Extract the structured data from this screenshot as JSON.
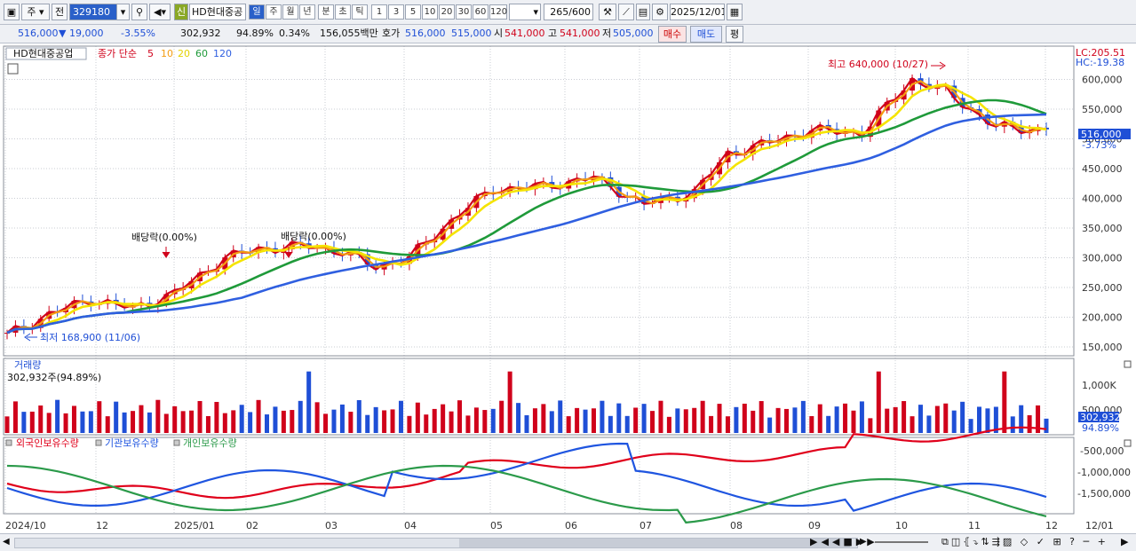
{
  "toolbar": {
    "mode_select": "주",
    "prev_label": "전",
    "code": "329180",
    "new_badge": "신",
    "stock_name": "HD현대중공",
    "periods": [
      "일",
      "주",
      "월",
      "년",
      "분",
      "초",
      "틱"
    ],
    "active_period": "일",
    "tick_units": [
      "1",
      "3",
      "5",
      "10",
      "20",
      "30",
      "60",
      "120"
    ],
    "count": "265",
    "count_max": "/600",
    "date": "2025/12/01"
  },
  "quote": {
    "price": "516,000",
    "change": "▼  19,000",
    "change_pct": "-3.55%",
    "volume": "302,932",
    "vol_ratio": "94.89%",
    "turnover_pct": "0.34%",
    "amount": "156,055백만",
    "quote_label": "호가",
    "ask": "516,000",
    "bid": "515,000",
    "open_label": "시",
    "open": "541,000",
    "high_label": "고",
    "high": "541,000",
    "low_label": "저",
    "low": "505,000",
    "buy": "매수",
    "sell": "매도",
    "eval": "평"
  },
  "colors": {
    "up": "#d0021b",
    "down": "#1f4fd6",
    "ma5": "#d0021b",
    "ma10": "#f39c12",
    "ma20": "#f5e400",
    "ma60": "#1f9a3a",
    "ma120": "#2f5fe0",
    "foreign": "#e0001b",
    "inst": "#1f55e0",
    "indiv": "#2b9a4a"
  },
  "price_panel": {
    "name_tag": "HD현대중공업",
    "legend_title": "종가 단순",
    "ma_periods": [
      "5",
      "10",
      "20",
      "60",
      "120"
    ],
    "lc_label": "LC:205.51",
    "hc_label": "HC:-19.38",
    "high_note": "최고 640,000 (10/27)",
    "low_note": "최저 168,900 (11/06)",
    "dividend_note": "배당락(0.00%)",
    "current_price_tag": "516,000",
    "current_pct_tag": "-3.73%",
    "y_labels": [
      "600,000",
      "550,000",
      "500,000",
      "450,000",
      "400,000",
      "350,000",
      "300,000",
      "250,000",
      "200,000",
      "150,000"
    ]
  },
  "volume_panel": {
    "title": "거래량",
    "value": "302,932주(94.89%)",
    "y_labels": [
      "1,000K",
      "500,000"
    ],
    "current_tag": "302,932",
    "ratio_tag": "94.89%"
  },
  "investor_panel": {
    "legend": [
      "외국인보유수량",
      "기관보유수량",
      "개인보유수량"
    ],
    "y_labels": [
      "-500,000",
      "-1,000,000",
      "-1,500,000"
    ]
  },
  "x_labels": [
    "2024/10",
    "12",
    "2025/01",
    "02",
    "03",
    "04",
    "05",
    "06",
    "07",
    "08",
    "09",
    "10",
    "11",
    "12",
    "12/01"
  ],
  "chart_data": {
    "type": "candlestick",
    "series_names": [
      "5",
      "10",
      "20",
      "60",
      "120"
    ],
    "close_anchors": [
      [
        0,
        170000
      ],
      [
        5,
        205000
      ],
      [
        10,
        230000
      ],
      [
        15,
        215000
      ],
      [
        20,
        240000
      ],
      [
        26,
        300000
      ],
      [
        30,
        315000
      ],
      [
        36,
        320000
      ],
      [
        40,
        310000
      ],
      [
        44,
        285000
      ],
      [
        48,
        300000
      ],
      [
        54,
        375000
      ],
      [
        58,
        415000
      ],
      [
        64,
        420000
      ],
      [
        70,
        435000
      ],
      [
        76,
        390000
      ],
      [
        82,
        410000
      ],
      [
        86,
        475000
      ],
      [
        90,
        490000
      ],
      [
        96,
        515000
      ],
      [
        102,
        510000
      ],
      [
        108,
        600000
      ],
      [
        112,
        580000
      ],
      [
        118,
        520000
      ],
      [
        124,
        515000
      ]
    ],
    "volume_range": [
      0,
      1500000
    ],
    "price_range": [
      150000,
      650000
    ]
  }
}
